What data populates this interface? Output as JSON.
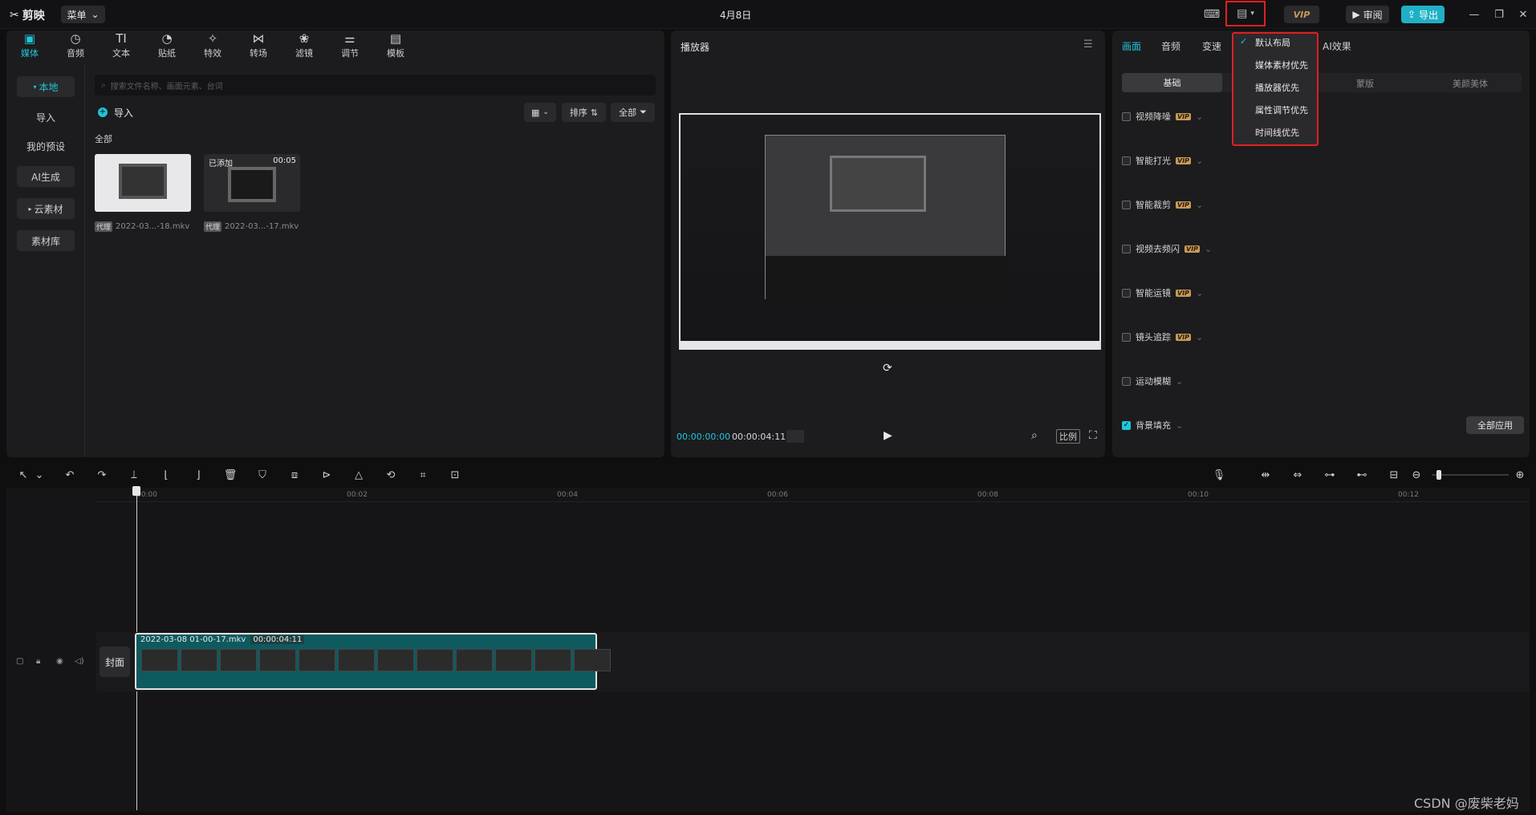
{
  "app": {
    "logo": "剪映",
    "menu_label": "菜单",
    "title": "4月8日",
    "vip_label": "VIP",
    "review_label": "审阅",
    "export_label": "导出"
  },
  "layout_menu": {
    "items": [
      {
        "label": "默认布局",
        "checked": true
      },
      {
        "label": "媒体素材优先"
      },
      {
        "label": "播放器优先"
      },
      {
        "label": "属性调节优先"
      },
      {
        "label": "时间线优先"
      }
    ]
  },
  "media_tabs": [
    {
      "label": "媒体",
      "icon": "media-icon"
    },
    {
      "label": "音频",
      "icon": "audio-icon"
    },
    {
      "label": "文本",
      "icon": "text-icon"
    },
    {
      "label": "贴纸",
      "icon": "sticker-icon"
    },
    {
      "label": "特效",
      "icon": "effects-icon"
    },
    {
      "label": "转场",
      "icon": "transition-icon"
    },
    {
      "label": "滤镜",
      "icon": "filter-icon"
    },
    {
      "label": "调节",
      "icon": "adjust-icon"
    },
    {
      "label": "模板",
      "icon": "template-icon"
    }
  ],
  "sidebar": {
    "items": [
      {
        "label": "本地"
      },
      {
        "label": "导入"
      },
      {
        "label": "我的预设"
      },
      {
        "label": "AI生成"
      },
      {
        "label": "云素材"
      },
      {
        "label": "素材库"
      }
    ]
  },
  "media": {
    "search_placeholder": "搜索文件名称、画面元素、台词",
    "import_label": "导入",
    "sort_label": "排序",
    "filter_label": "全部",
    "section_label": "全部",
    "items": [
      {
        "name": "2022-03...-18.mkv",
        "proxy": "代理",
        "added": "",
        "duration": ""
      },
      {
        "name": "2022-03...-17.mkv",
        "proxy": "代理",
        "added": "已添加",
        "duration": "00:05"
      }
    ]
  },
  "player": {
    "title": "播放器",
    "current_time": "00:00:00:00",
    "total_time": "00:00:04:11",
    "ratio_label": "比例"
  },
  "props": {
    "tabs": [
      "画面",
      "音频",
      "变速",
      "AI效果"
    ],
    "subtabs": [
      "基础",
      "",
      "蒙版",
      "美颜美体"
    ],
    "rows": [
      {
        "label": "视频降噪",
        "vip": true,
        "checked": false
      },
      {
        "label": "智能打光",
        "vip": true,
        "checked": false
      },
      {
        "label": "智能裁剪",
        "vip": true,
        "checked": false
      },
      {
        "label": "视频去频闪",
        "vip": true,
        "checked": false
      },
      {
        "label": "智能运镜",
        "vip": true,
        "checked": false
      },
      {
        "label": "镜头追踪",
        "vip": true,
        "checked": false
      },
      {
        "label": "运动模糊",
        "vip": false,
        "checked": false
      },
      {
        "label": "背景填充",
        "vip": false,
        "checked": true
      }
    ],
    "apply_all_label": "全部应用",
    "vip_badge": "VIP"
  },
  "timeline": {
    "ticks": [
      "00:00",
      "00:02",
      "00:04",
      "00:06",
      "00:08",
      "00:10",
      "00:12"
    ],
    "clip_name": "2022-03-08 01-00-17.mkv",
    "clip_duration": "00:00:04:11",
    "cover_label": "封面"
  },
  "watermark": "CSDN @废柴老妈",
  "colors": {
    "accent": "#1fc5d9",
    "highlight_box": "#e02020",
    "vip_gold": "#c99a59"
  }
}
